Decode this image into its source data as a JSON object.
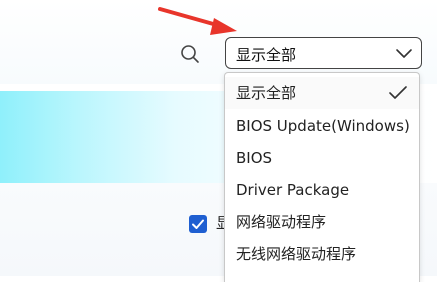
{
  "filter": {
    "selected": "显示全部",
    "options": [
      "显示全部",
      "BIOS Update(Windows)",
      "BIOS",
      "Driver Package",
      "网络驱动程序",
      "无线网络驱动程序"
    ]
  },
  "checkbox": {
    "checked": true,
    "label_partial": "显"
  },
  "colors": {
    "arrow": "#e8352b",
    "checkbox": "#1f5fd1",
    "banner_start": "#8ff0fb"
  },
  "icons": {
    "search": "search-icon",
    "chevron": "chevron-down-icon",
    "check": "checkmark-icon"
  }
}
